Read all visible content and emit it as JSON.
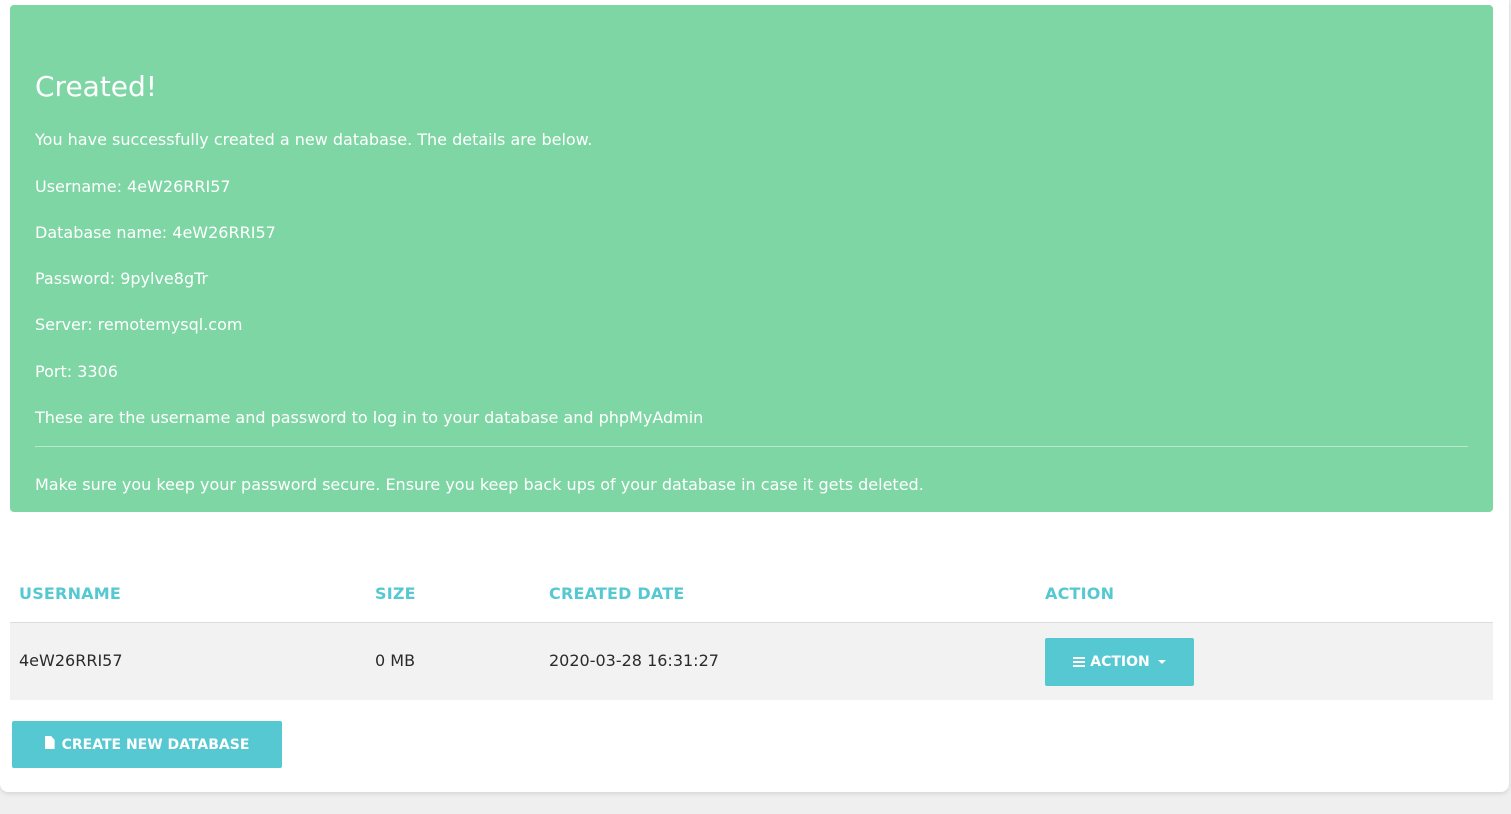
{
  "alert": {
    "title": "Created!",
    "intro": "You have successfully created a new database. The details are below.",
    "username_line": "Username: 4eW26RRI57",
    "dbname_line": "Database name: 4eW26RRI57",
    "password_line": "Password: 9pylve8gTr",
    "server_line": "Server: remotemysql.com",
    "port_line": "Port: 3306",
    "login_note": "These are the username and password to log in to your database and phpMyAdmin",
    "security_note": "Make sure you keep your password secure. Ensure you keep back ups of your database in case it gets deleted."
  },
  "table": {
    "headers": {
      "username": "USERNAME",
      "size": "SIZE",
      "created": "CREATED DATE",
      "action": "ACTION"
    },
    "rows": [
      {
        "username": "4eW26RRI57",
        "size": "0 MB",
        "created": "2020-03-28 16:31:27",
        "action_label": "ACTION"
      }
    ]
  },
  "buttons": {
    "create_label": "CREATE NEW DATABASE"
  },
  "colors": {
    "success": "#7fd6a5",
    "accent": "#55c8d1"
  },
  "icons": {
    "action": "bars-icon",
    "action_caret": "caret-down-icon",
    "create": "file-icon"
  }
}
